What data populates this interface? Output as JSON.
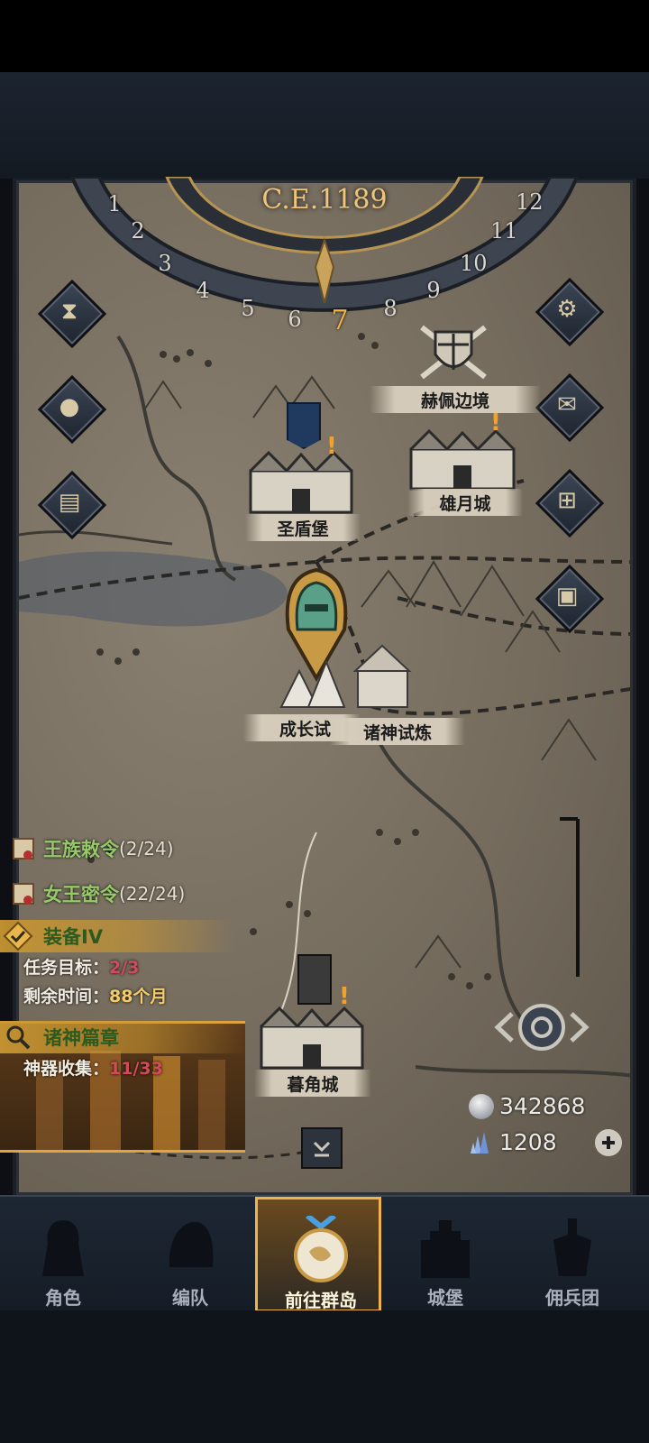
{
  "calendar": {
    "year": "C.E.1189",
    "months": [
      "1",
      "2",
      "3",
      "4",
      "5",
      "6",
      "7",
      "8",
      "9",
      "10",
      "11",
      "12"
    ],
    "current_month": "7"
  },
  "left_buttons": [
    {
      "name": "hourglass-icon"
    },
    {
      "name": "money-bag-icon"
    },
    {
      "name": "scroll-icon"
    }
  ],
  "right_buttons": [
    {
      "name": "gear-icon"
    },
    {
      "name": "mail-icon"
    },
    {
      "name": "window-icon"
    },
    {
      "name": "supplies-icon"
    }
  ],
  "locations": {
    "hepei": "赫佩边境",
    "shengdun": "圣盾堡",
    "xiongyue": "雄月城",
    "chengzhang": "成长试",
    "zhushen": "诸神试炼",
    "mujiao": "暮角城"
  },
  "quests": {
    "royal_decree": {
      "label": "王族敕令",
      "count": "(2/24)"
    },
    "queen_order": {
      "label": "女王密令",
      "count": "(22/24)"
    },
    "equipment": {
      "label": "装备IV"
    },
    "equip_target_label": "任务目标：",
    "equip_target_value": "2/3",
    "equip_time_label": "剩余时间：",
    "equip_time_value": "88个月",
    "gods_chapter": {
      "label": "诸神篇章"
    },
    "artifact_label": "神器收集：",
    "artifact_value": "11/33"
  },
  "currency": {
    "silver": "342868",
    "crystal": "1208"
  },
  "nav": [
    {
      "label": "角色"
    },
    {
      "label": "编队"
    },
    {
      "label": "前往群岛"
    },
    {
      "label": "城堡"
    },
    {
      "label": "佣兵团"
    }
  ],
  "colors": {
    "accent_gold": "#f0b24a",
    "quest_green": "#97c96a",
    "progress_red": "#d24b5a"
  }
}
